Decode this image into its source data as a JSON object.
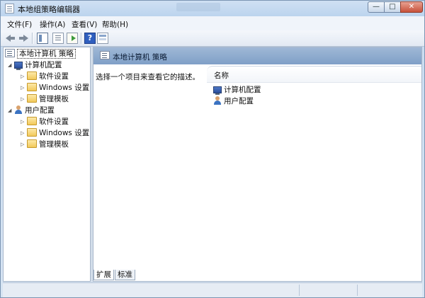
{
  "window": {
    "title": "本地组策略编辑器",
    "controls": {
      "minimize": "—",
      "maximize": "□",
      "close": "✕"
    }
  },
  "menu": [
    "文件(F)",
    "操作(A)",
    "查看(V)",
    "帮助(H)"
  ],
  "toolbar": {
    "help_glyph": "?"
  },
  "tree": {
    "root": "本地计算机 策略",
    "computer": {
      "label": "计算机配置",
      "children": [
        "软件设置",
        "Windows 设置",
        "管理模板"
      ]
    },
    "user": {
      "label": "用户配置",
      "children": [
        "软件设置",
        "Windows 设置",
        "管理模板"
      ]
    }
  },
  "details": {
    "header": "本地计算机 策略",
    "description": "选择一个项目来查看它的描述。",
    "column_name": "名称",
    "items": [
      "计算机配置",
      "用户配置"
    ]
  },
  "tabs": [
    "扩展",
    "标准"
  ],
  "colors": {
    "path_bar": "#8fabd0",
    "window_frame": "#c9dcf1",
    "close_button": "#c7513a"
  }
}
